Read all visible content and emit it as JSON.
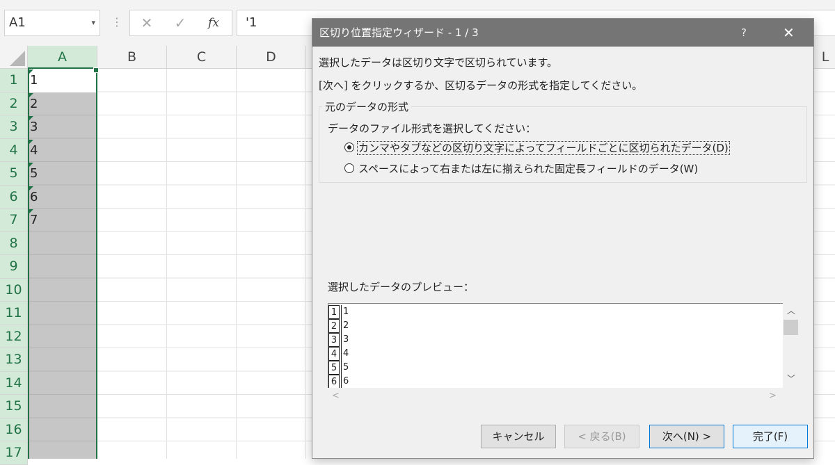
{
  "formula_bar": {
    "name_box": "A1",
    "name_box_dropdown_icon": "chevron-down-icon",
    "cancel_icon": "✕",
    "enter_icon": "✓",
    "fx_label": "fx",
    "content": "'1"
  },
  "sheet": {
    "columns": [
      "A",
      "B",
      "C",
      "D"
    ],
    "extra_column": "L",
    "row_numbers": [
      "1",
      "2",
      "3",
      "4",
      "5",
      "6",
      "7",
      "8",
      "9",
      "10",
      "11",
      "12",
      "13",
      "14",
      "15",
      "16",
      "17"
    ],
    "column_a_values": [
      "1",
      "2",
      "3",
      "4",
      "5",
      "6",
      "7"
    ],
    "selection_color": "#217346"
  },
  "dialog": {
    "title": "区切り位置指定ウィザード - 1 / 3",
    "help_label": "?",
    "close_label": "✕",
    "intro_line1": "選択したデータは区切り文字で区切られています。",
    "intro_line2": "[次へ] をクリックするか、区切るデータの形式を指定してください。",
    "group_title": "元のデータの形式",
    "file_format_prompt": "データのファイル形式を選択してください：",
    "option_delimited": "カンマやタブなどの区切り文字によってフィールドごとに区切られたデータ(D)",
    "option_fixed": "スペースによって右または左に揃えられた固定長フィールドのデータ(W)",
    "selected_option": "delimited",
    "preview_label": "選択したデータのプレビュー：",
    "preview_rows": [
      {
        "num": "1",
        "value": "1"
      },
      {
        "num": "2",
        "value": "2"
      },
      {
        "num": "3",
        "value": "3"
      },
      {
        "num": "4",
        "value": "4"
      },
      {
        "num": "5",
        "value": "5"
      },
      {
        "num": "6",
        "value": "6"
      }
    ],
    "buttons": {
      "cancel": "キャンセル",
      "back": "< 戻る(B)",
      "next": "次へ(N) >",
      "finish": "完了(F)"
    },
    "title_bar_color": "#757575"
  }
}
